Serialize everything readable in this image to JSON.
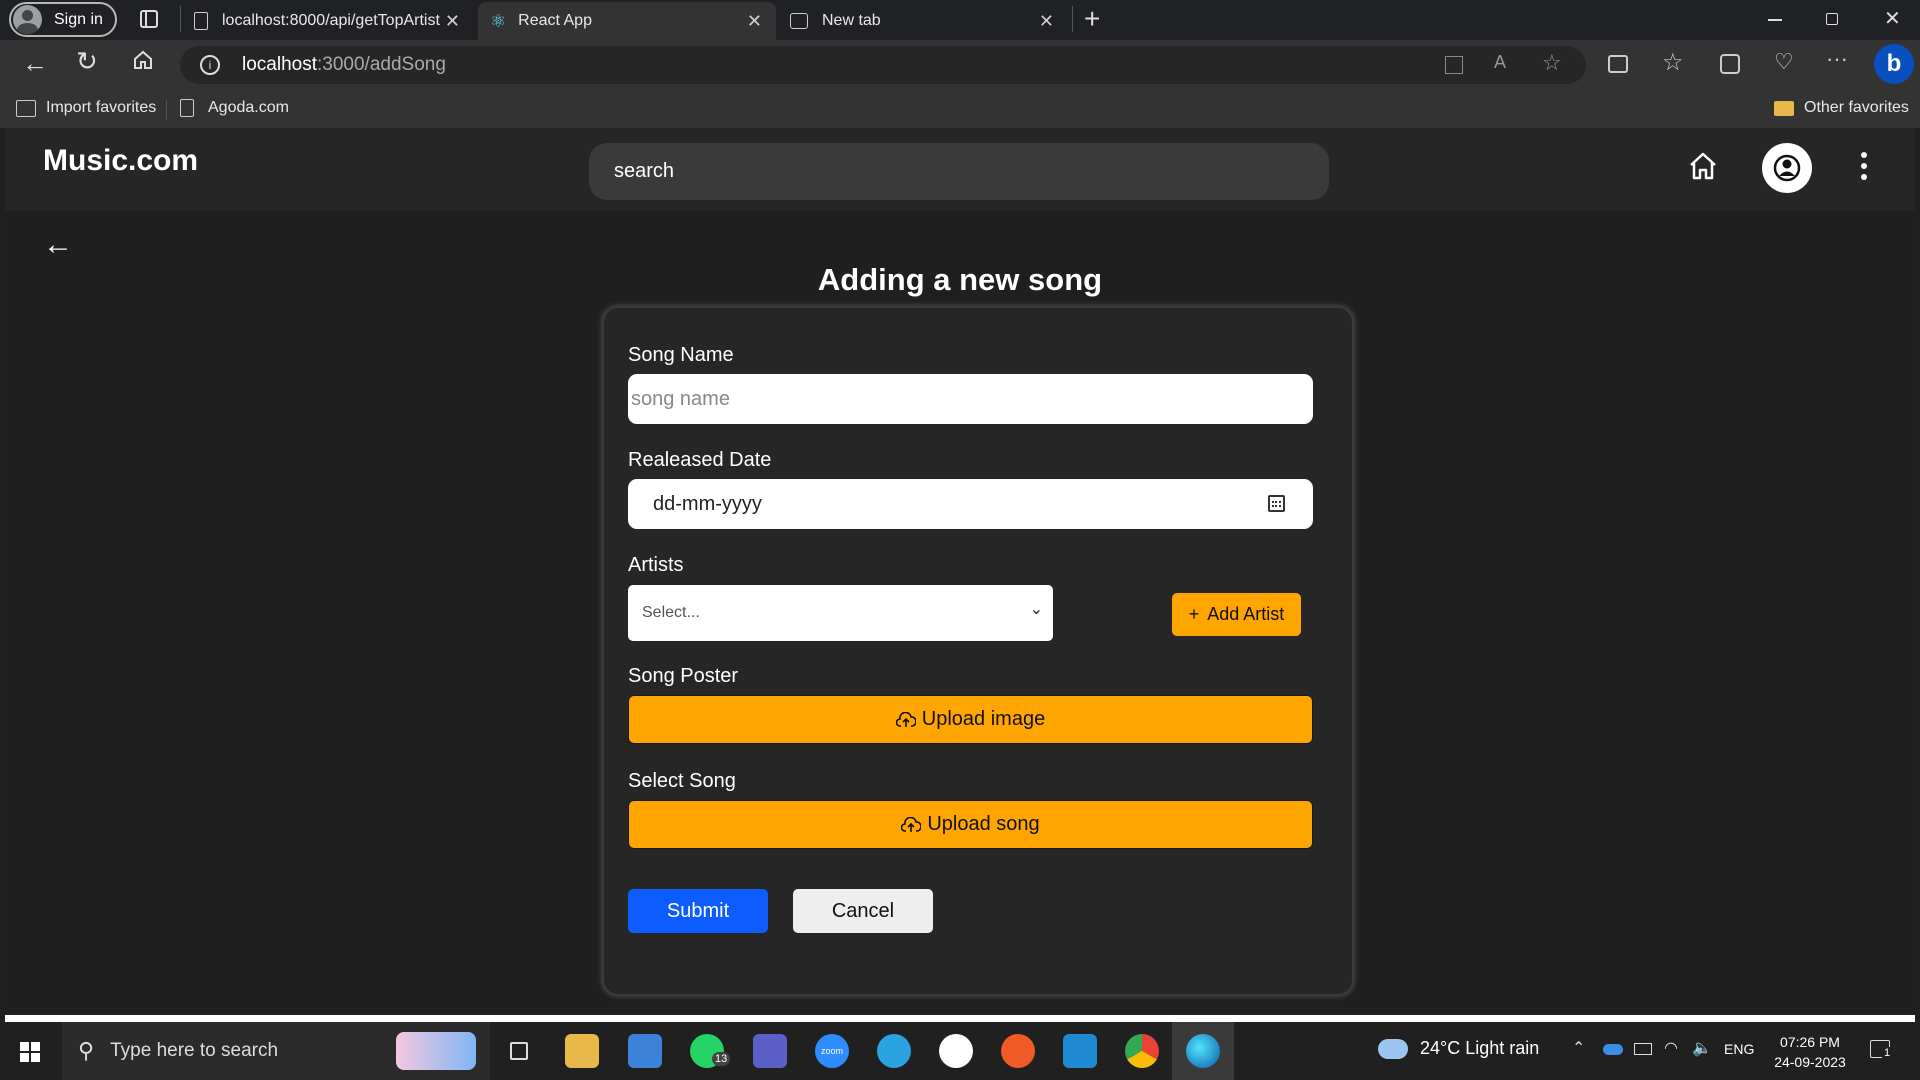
{
  "browser": {
    "signin_label": "Sign in",
    "tabs": [
      {
        "title": "localhost:8000/api/getTopArtist",
        "icon": "page-icon"
      },
      {
        "title": "React App",
        "icon": "react-icon"
      },
      {
        "title": "New tab",
        "icon": "newtab-icon"
      }
    ],
    "url_host": "localhost",
    "url_path": ":3000/addSong",
    "favorites": [
      "Import favorites",
      "Agoda.com"
    ],
    "other_favorites": "Other favorites"
  },
  "app": {
    "logo": "Music.com",
    "search_placeholder": "search",
    "page_title": "Adding a new song",
    "form": {
      "song_name_label": "Song Name",
      "song_name_placeholder": "song name",
      "date_label": "Realeased Date",
      "date_placeholder": "dd-mm-yyyy",
      "artists_label": "Artists",
      "artists_select_value": "Select...",
      "add_artist_label": "Add Artist",
      "poster_label": "Song Poster",
      "upload_image_label": "Upload image",
      "song_label": "Select Song",
      "upload_song_label": "Upload song",
      "submit_label": "Submit",
      "cancel_label": "Cancel"
    },
    "accent_color": "#ffa500",
    "submit_color": "#0d5cff"
  },
  "taskbar": {
    "search_placeholder": "Type here to search",
    "whatsapp_badge": "13",
    "zoom_label": "zoom",
    "weather": "24°C  Light rain",
    "lang": "ENG",
    "time": "07:26 PM",
    "date": "24-09-2023",
    "notifications": "1"
  }
}
